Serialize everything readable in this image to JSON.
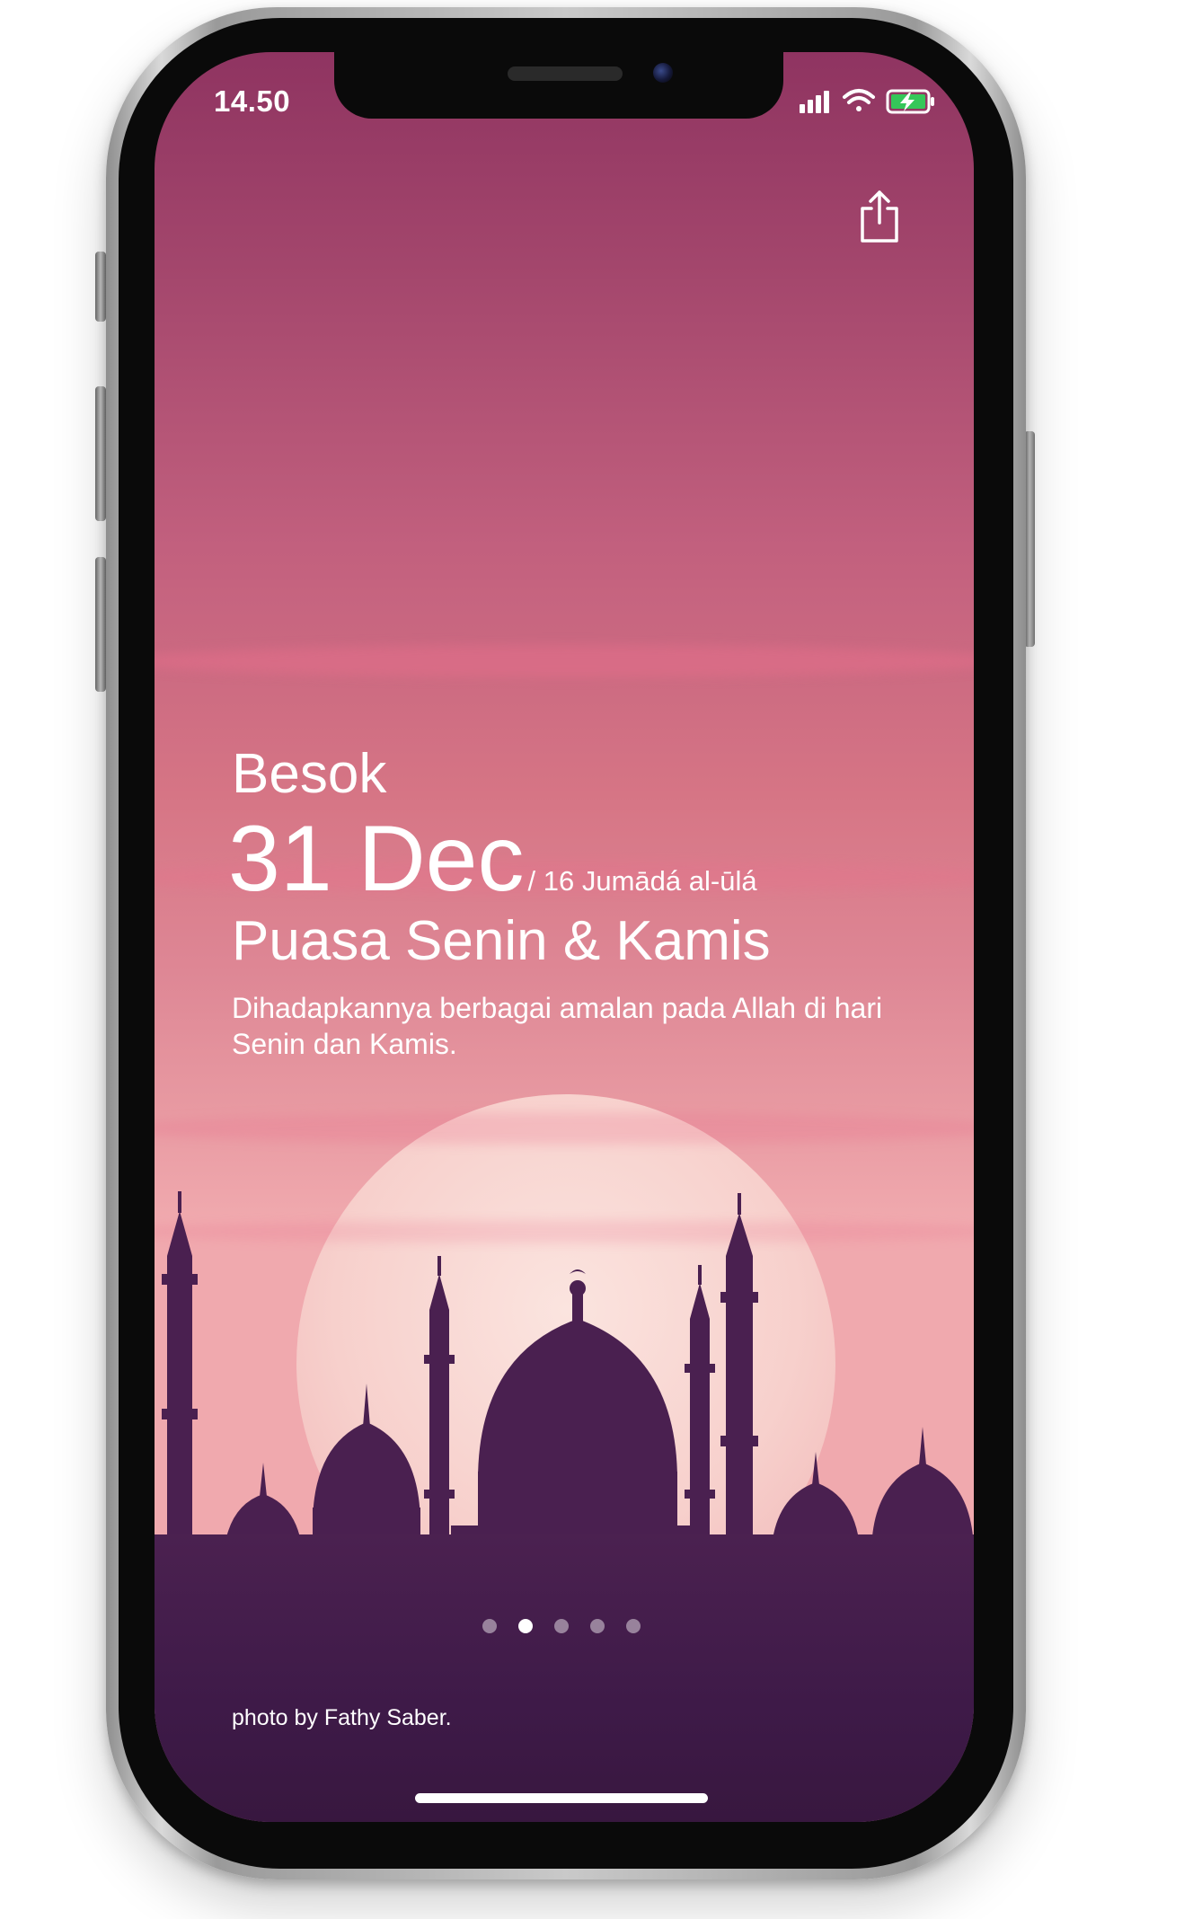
{
  "status_bar": {
    "time": "14.50",
    "icons": [
      "signal-icon",
      "wifi-icon",
      "battery-charging-icon"
    ]
  },
  "header": {
    "share_icon": "share-icon"
  },
  "event": {
    "day_label": "Besok",
    "date": "31 Dec",
    "hijri_date": "/ 16 Jumādá al-ūlá",
    "title": "Puasa Senin & Kamis",
    "description": "Dihadapkannya berbagai amalan pada Allah di hari Senin dan Kamis."
  },
  "pager": {
    "count": 5,
    "active_index": 1
  },
  "credit": "photo by Fathy Saber.",
  "colors": {
    "sky_top": "#8f3461",
    "sky_bottom": "#f0a9ae",
    "silhouette": "#4a2050",
    "text": "#ffffff"
  }
}
